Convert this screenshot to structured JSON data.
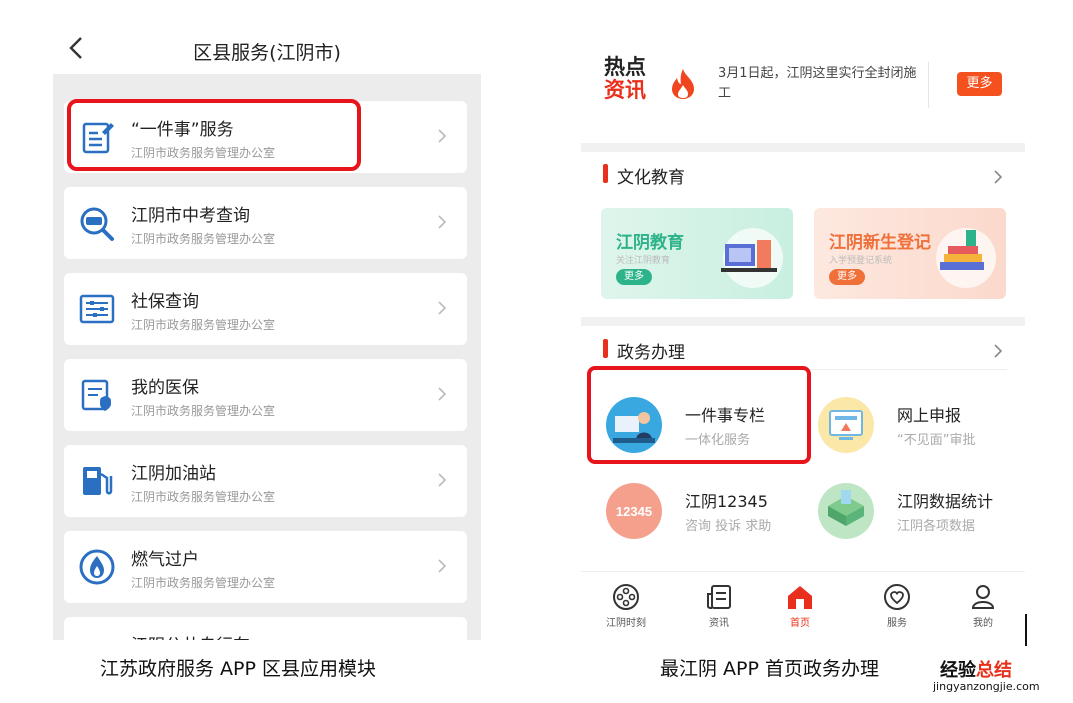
{
  "left_screen": {
    "title": "区县服务(江阴市)",
    "rows": [
      {
        "title": "“一件事”服务",
        "subtitle": "江阴市政务服务管理办公室",
        "icon": "edit-document-icon"
      },
      {
        "title": "江阴市中考查询",
        "subtitle": "江阴市政务服务管理办公室",
        "icon": "exam-search-icon"
      },
      {
        "title": "社保查询",
        "subtitle": "江阴市政务服务管理办公室",
        "icon": "social-security-icon"
      },
      {
        "title": "我的医保",
        "subtitle": "江阴市政务服务管理办公室",
        "icon": "medical-insurance-icon"
      },
      {
        "title": "江阴加油站",
        "subtitle": "江阴市政务服务管理办公室",
        "icon": "fuel-pump-icon"
      },
      {
        "title": "燃气过户",
        "subtitle": "江阴市政务服务管理办公室",
        "icon": "gas-flame-icon"
      },
      {
        "title": "江阴公共自行车",
        "subtitle": "",
        "icon": "bike-icon"
      }
    ]
  },
  "right_screen": {
    "hot_news": {
      "title_line1": "热点",
      "title_line2": "资讯",
      "headline": "3月1日起，江阴这里实行全封闭施工",
      "more_label": "更多"
    },
    "culture_section": {
      "title": "文化教育",
      "cards": [
        {
          "title": "江阴教育",
          "subtitle": "关注江阴教育",
          "more": "更多"
        },
        {
          "title": "江阴新生登记",
          "subtitle": "入学预登记系统",
          "more": "更多"
        }
      ]
    },
    "gov_section": {
      "title": "政务办理",
      "services": [
        {
          "title": "一件事专栏",
          "subtitle": "一体化服务"
        },
        {
          "title": "网上申报",
          "subtitle": "“不见面”审批"
        },
        {
          "title": "江阴12345",
          "subtitle": "咨询 投诉 求助",
          "badge": "12345"
        },
        {
          "title": "江阴数据统计",
          "subtitle": "江阴各项数据"
        }
      ]
    },
    "tabs": [
      {
        "label": "江阴时刻",
        "icon": "film-reel-icon"
      },
      {
        "label": "资讯",
        "icon": "news-icon"
      },
      {
        "label": "首页",
        "icon": "home-icon",
        "active": true
      },
      {
        "label": "服务",
        "icon": "heart-service-icon"
      },
      {
        "label": "我的",
        "icon": "user-icon"
      }
    ]
  },
  "captions": {
    "left": "江苏政府服务 APP 区县应用模块",
    "right": "最江阴 APP 首页政务办理"
  },
  "watermark": {
    "text_a": "经验",
    "text_b": "总结",
    "url": "jingyanzongjie.com"
  },
  "colors": {
    "accent_red": "#e8301c",
    "highlight_red": "#e8141b",
    "icon_blue": "#2b6fc2",
    "active_tab": "#e8301c"
  }
}
